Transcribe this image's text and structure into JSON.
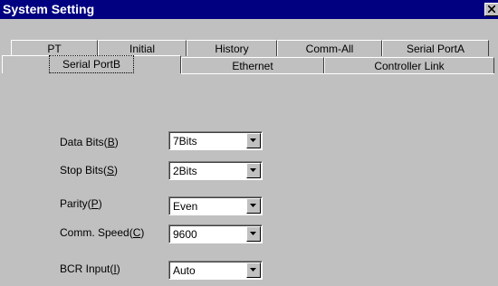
{
  "window": {
    "title": "System Setting"
  },
  "tabs_row1": [
    "PT",
    "Initial",
    "History",
    "Comm-All",
    "Serial PortA"
  ],
  "tabs_row2": [
    "Serial PortB",
    "Ethernet",
    "Controller Link"
  ],
  "active_tab": "Serial PortB",
  "form": [
    {
      "label_pre": "Data Bits(",
      "mnemonic": "B",
      "label_post": ")",
      "value": "7Bits"
    },
    {
      "label_pre": "Stop Bits(",
      "mnemonic": "S",
      "label_post": ")",
      "value": "2Bits"
    },
    {
      "label_pre": "Parity(",
      "mnemonic": "P",
      "label_post": ")",
      "value": "Even"
    },
    {
      "label_pre": "Comm. Speed(",
      "mnemonic": "C",
      "label_post": ")",
      "value": "9600"
    },
    {
      "label_pre": "BCR Input(",
      "mnemonic": "I",
      "label_post": ")",
      "value": "Auto"
    }
  ]
}
